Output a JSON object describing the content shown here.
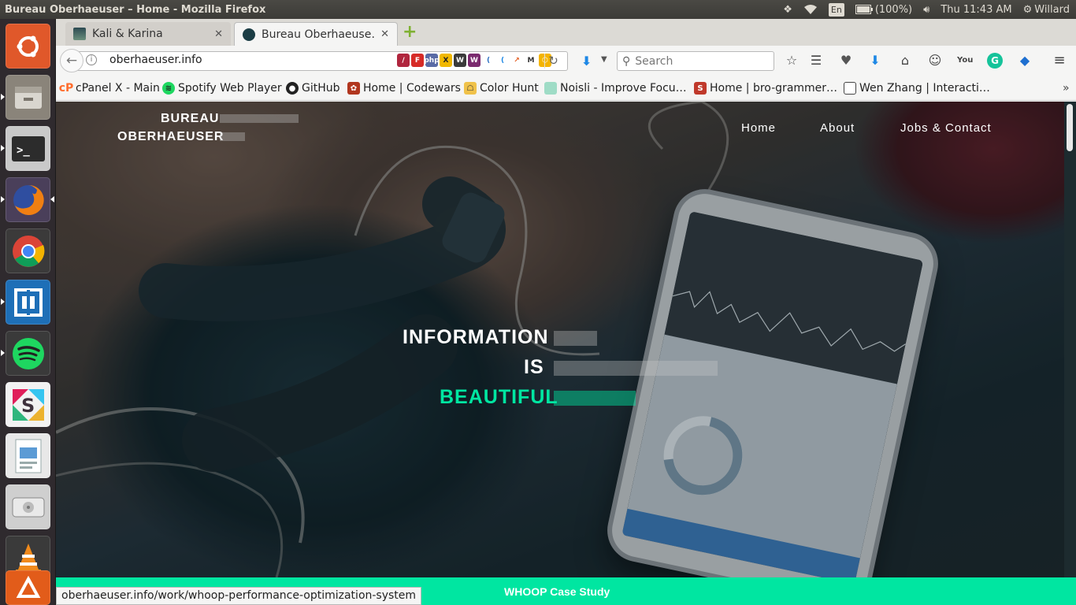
{
  "top_panel": {
    "window_title": "Bureau Oberhaeuser – Home - Mozilla Firefox",
    "keyboard_layout": "En",
    "battery": "(100%)",
    "clock": "Thu 11:43 AM",
    "user": "Willard"
  },
  "launcher": {
    "items": [
      "Ubuntu Dash",
      "Files",
      "Terminal",
      "Firefox",
      "Chrome",
      "Remote Desktop",
      "Spotify",
      "Slack",
      "LibreOffice Impress",
      "Disks",
      "VLC",
      "Software Updater"
    ]
  },
  "tabs": [
    {
      "label": "Kali & Karina",
      "active": false
    },
    {
      "label": "Bureau Oberhaeuse…",
      "active": true
    }
  ],
  "navbar": {
    "url": "oberhaeuser.info",
    "search_placeholder": "Search"
  },
  "bookmarks": [
    {
      "label": "cPanel X - Main"
    },
    {
      "label": "Spotify Web Player"
    },
    {
      "label": "GitHub"
    },
    {
      "label": "Home | Codewars"
    },
    {
      "label": "Color Hunt"
    },
    {
      "label": "Noisli - Improve Focu…"
    },
    {
      "label": "Home | bro-grammer…"
    },
    {
      "label": "Wen Zhang | Interacti…"
    }
  ],
  "site": {
    "brand_line1": "BUREAU",
    "brand_line2": "OBERHAEUSER",
    "nav": [
      "Home",
      "About",
      "Jobs & Contact"
    ],
    "hero": {
      "word1": "INFORMATION",
      "word2": "IS",
      "word3": "BEAUTIFUL",
      "accent_color": "#00e6a1"
    },
    "cta": "WHOOP Case Study"
  },
  "status_link": "oberhaeuser.info/work/whoop-performance-optimization-system"
}
